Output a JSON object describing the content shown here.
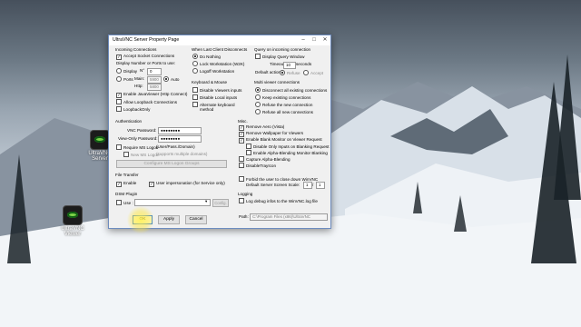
{
  "window": {
    "title": "UltraVNC Server Property Page",
    "controls": [
      "–",
      "□",
      "✕"
    ]
  },
  "incoming": {
    "header": "Incoming Connections",
    "accept_socket": "Accept Socket Connections",
    "display_label": "Display Number or Ports to use:",
    "display_radio": "Display",
    "n_label": "N°",
    "n_value": "0",
    "ports_radio": "Ports",
    "auto_radio": "Auto",
    "main_label": "Main:",
    "main_value": "5900",
    "http_label": "Http:",
    "http_value": "5800",
    "enable_java": "Enable JavaViewer (Http Connect)",
    "allow_loopback": "Allow Loopback Connections",
    "loopback_only": "LoopbackOnly"
  },
  "last_client": {
    "header": "When Last Client Disconnects",
    "do_nothing": "Do Nothing",
    "lock": "Lock Workstation (W2K)",
    "logoff": "Logoff Workstation"
  },
  "query": {
    "header": "Query on incoming connection",
    "display_query": "Display Query Window",
    "timeout_label": "Timeout:",
    "timeout_value": "10",
    "seconds": "seconds",
    "default_action": "Default action:",
    "refuse": "Refuse",
    "accept": "Accept"
  },
  "keyboard": {
    "header": "Keyboard & Mouse",
    "disable_viewers": "Disable Viewers inputs",
    "disable_local": "Disable Local inputs",
    "alternate_1": "Alternate keyboard",
    "alternate_2": "method"
  },
  "multi": {
    "header": "Multi viewer connections",
    "disconnect_all": "Disconnect all existing connections",
    "keep_all": "Keep existing connections",
    "refuse_new": "Refuse the new connection",
    "refuse_all": "Refuse all new connections"
  },
  "auth": {
    "header": "Authentication",
    "vnc_password": "VNC Password:",
    "vnc_password_value": "●●●●●●●●",
    "view_only": "View-Only Password:",
    "view_only_value": "●●●●●●●●",
    "require_ms": "Require MS Logon",
    "ms_hint": "(User/Pass./Domain)",
    "new_ms": "New MS Logon",
    "new_ms_hint": "(supports multiple domains)",
    "configure_btn": "Configure MS Logon Groups"
  },
  "misc": {
    "header": "Misc.",
    "remove_aero": "Remove Aero (Vista)",
    "remove_wallpaper": "Remove Wallpaper for Viewers",
    "enable_blank": "Enable Blank Monitor on Viewer Request",
    "disable_only": "Disable Only Inputs on Blanking Request",
    "enable_alpha": "Enable Alpha-Blending Monitor Blanking",
    "capture_alpha": "Capture Alpha-Blending",
    "disable_tray": "DisableTrayIcon"
  },
  "file_transfer": {
    "header": "File Transfer",
    "enable": "Enable",
    "user_impersonation": "User impersonation (for Service only)"
  },
  "forbid": {
    "line1": "Forbid the user to close down WinVNC",
    "line2": "Default Server Screen Scale:",
    "scale_a": "1",
    "slash": "/",
    "scale_b": "1"
  },
  "dsm": {
    "header": "DSM Plugin",
    "use": "Use :",
    "config_btn": "Config."
  },
  "logging": {
    "header": "Logging",
    "log_debug": "Log debug infos to the WinVNC.log file",
    "path_label": "Path:",
    "path_value": "C:\\Program Files (x86)\\UltraVNC"
  },
  "buttons": {
    "ok": "OK",
    "apply": "Apply",
    "cancel": "Cancel"
  },
  "desktop": {
    "icon1": "UltraVNC Server",
    "icon2": "UltraVNC Viewer"
  },
  "colors": {
    "highlight": "#ffe84a",
    "default_button_border": "#2c7ad8"
  }
}
